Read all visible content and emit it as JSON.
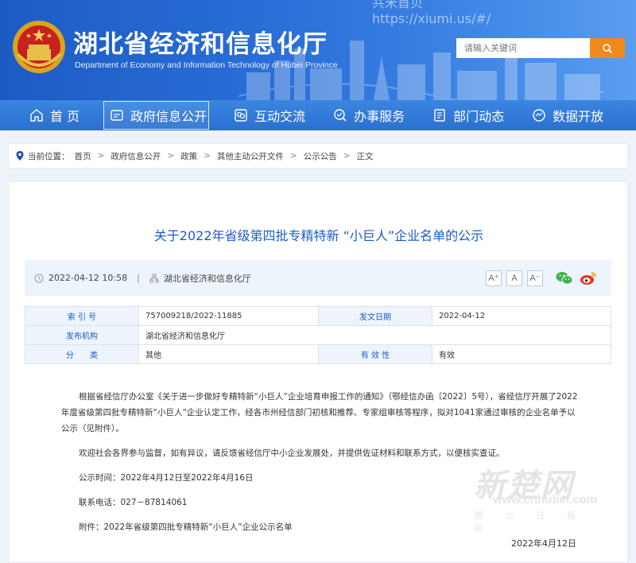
{
  "header": {
    "watermark": "共米首贝\nhttps://xiumi.us/#/",
    "title": "湖北省经济和信息化厅",
    "subtitle": "Department of Economy and Information Technology of Hubei Province",
    "search_placeholder": "请输入关键词"
  },
  "nav": {
    "items": [
      {
        "label": "首 页",
        "icon": "home-icon"
      },
      {
        "label": "政府信息公开",
        "icon": "document-icon"
      },
      {
        "label": "互动交流",
        "icon": "chat-icon"
      },
      {
        "label": "办事服务",
        "icon": "service-icon"
      },
      {
        "label": "部门动态",
        "icon": "news-icon"
      },
      {
        "label": "数据开放",
        "icon": "data-icon"
      }
    ]
  },
  "breadcrumb": {
    "prefix": "当前位置：",
    "items": [
      "首页",
      "政府信息公开",
      "政策",
      "其他主动公开文件",
      "公示公告",
      "正文"
    ]
  },
  "article": {
    "title": "关于2022年省级第四批专精特新 “小巨人”企业名单的公示",
    "date": "2022-04-12 10:58",
    "source": "湖北省经济和信息化厅",
    "font_buttons": [
      "A⁺",
      "A",
      "A⁻"
    ],
    "info": {
      "index_label": "索 引 号",
      "index_value": "757009218/2022-11885",
      "date_label": "发文日期",
      "date_value": "2022-04-12",
      "org_label": "发布机构",
      "org_value": "湖北省经济和信息化厅",
      "cat_label": "分　　类",
      "cat_value": "其他",
      "valid_label": "有 效 性",
      "valid_value": "有效"
    },
    "body": [
      "根据省经信厅办公室《关于进一步做好专精特新“小巨人”企业培育申报工作的通知》（鄂经信办函〔2022〕5号），省经信厅开展了2022年度省级第四批专精特新“小巨人”企业认定工作，经各市州经信部门初核和推荐、专家组审核等程序，拟对1041家通过审核的企业名单予以公示（见附件）。",
      "欢迎社会各界参与监督，如有异议，请反馈省经信厅中小企业发展处，并提供佐证材料和联系方式，以便核实查证。",
      "公示时间：2022年4月12日至2022年4月16日",
      "联系电话：027－87814061",
      "附件：2022年省级第四批专精特新“小巨人”企业公示名单"
    ],
    "sign_date": "2022年4月12日"
  },
  "watermark": {
    "brand": "新楚网",
    "url": "www.cnhubei.com",
    "caption": "湖北日报网"
  }
}
